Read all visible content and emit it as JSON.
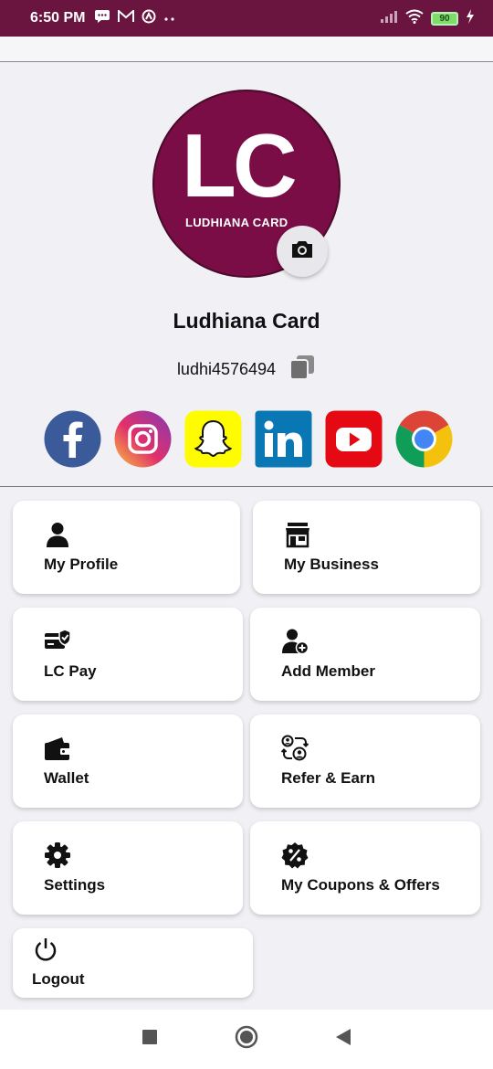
{
  "status_bar": {
    "time": "6:50 PM",
    "battery": "90",
    "icons": [
      "chat-icon",
      "gmail-icon",
      "app-icon",
      "more-dots-icon",
      "signal-icon",
      "wifi-icon",
      "battery-icon",
      "charging-icon"
    ]
  },
  "profile": {
    "logo_text": "LC",
    "logo_subtext": "LUDHIANA CARD",
    "name": "Ludhiana Card",
    "user_id": "ludhi4576494"
  },
  "socials": [
    "facebook",
    "instagram",
    "snapchat",
    "linkedin",
    "youtube",
    "chrome"
  ],
  "menu": {
    "my_profile": "My Profile",
    "my_business": "My Business",
    "lc_pay": "LC Pay",
    "add_member": "Add Member",
    "wallet": "Wallet",
    "refer_earn": "Refer & Earn",
    "settings": "Settings",
    "coupons": "My Coupons & Offers",
    "logout": "Logout"
  },
  "colors": {
    "brand": "#7a0d45",
    "status_bar": "#6a1440"
  }
}
